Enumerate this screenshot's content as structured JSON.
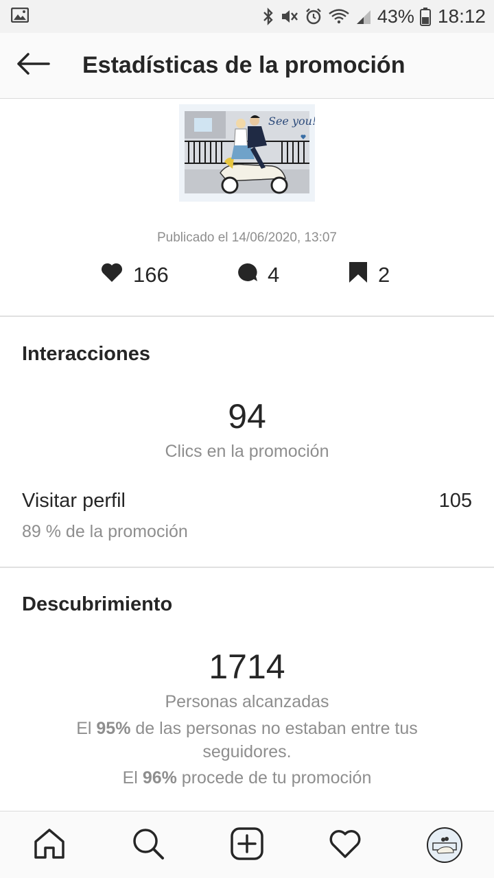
{
  "status_bar": {
    "battery_percent": "43%",
    "time": "18:12",
    "icons": [
      "image-icon",
      "bluetooth-icon",
      "mute-icon",
      "alarm-icon",
      "wifi-icon",
      "signal-icon",
      "battery-icon"
    ]
  },
  "header": {
    "title": "Estadísticas de la promoción",
    "back_icon": "arrow-left-icon"
  },
  "post": {
    "thumbnail": "scooter-illustration",
    "thumbnail_text": "See you!",
    "published": "Publicado el 14/06/2020, 13:07",
    "likes": "166",
    "comments": "4",
    "saves": "2"
  },
  "interactions": {
    "title": "Interacciones",
    "clicks_value": "94",
    "clicks_label": "Clics en la promoción",
    "visit_profile_label": "Visitar perfil",
    "visit_profile_value": "105",
    "visit_profile_sub": "89 % de la promoción"
  },
  "discovery": {
    "title": "Descubrimiento",
    "reach_value": "1714",
    "reach_label": "Personas alcanzadas",
    "non_followers_prefix": "El ",
    "non_followers_pct": "95%",
    "non_followers_suffix": " de las personas no estaban entre tus seguidores.",
    "from_promo_prefix": "El ",
    "from_promo_pct": "96%",
    "from_promo_suffix": " procede de tu promoción"
  },
  "bottom_nav": {
    "items": [
      "home-icon",
      "search-icon",
      "add-post-icon",
      "activity-heart-icon",
      "profile-avatar"
    ]
  },
  "colors": {
    "text_primary": "#262626",
    "text_secondary": "#8e8e8e",
    "divider": "#e0e0e0",
    "status_bar_bg": "#f2f2f2"
  }
}
